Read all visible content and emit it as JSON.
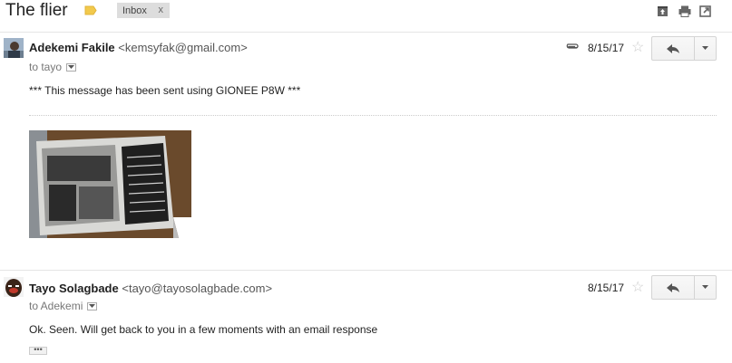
{
  "subject": "The flier",
  "label_chip": {
    "label": "Inbox",
    "remove": "x"
  },
  "top_actions": [
    "archive-icon",
    "print-icon",
    "open-in-new-window-icon"
  ],
  "messages": [
    {
      "sender_name": "Adekemi Fakile",
      "sender_email": "<kemsyfak@gmail.com>",
      "to": "to tayo",
      "date": "8/15/17",
      "has_attachment": true,
      "body": "*** This message has been sent using GIONEE P8W ***",
      "attachment": "photo of a printed flier"
    },
    {
      "sender_name": "Tayo Solagbade",
      "sender_email": "<tayo@tayosolagbade.com>",
      "to": "to Adekemi",
      "date": "8/15/17",
      "has_attachment": false,
      "body": "Ok. Seen. Will get back to you in a few moments with an email response",
      "trimmed": "•••"
    }
  ]
}
